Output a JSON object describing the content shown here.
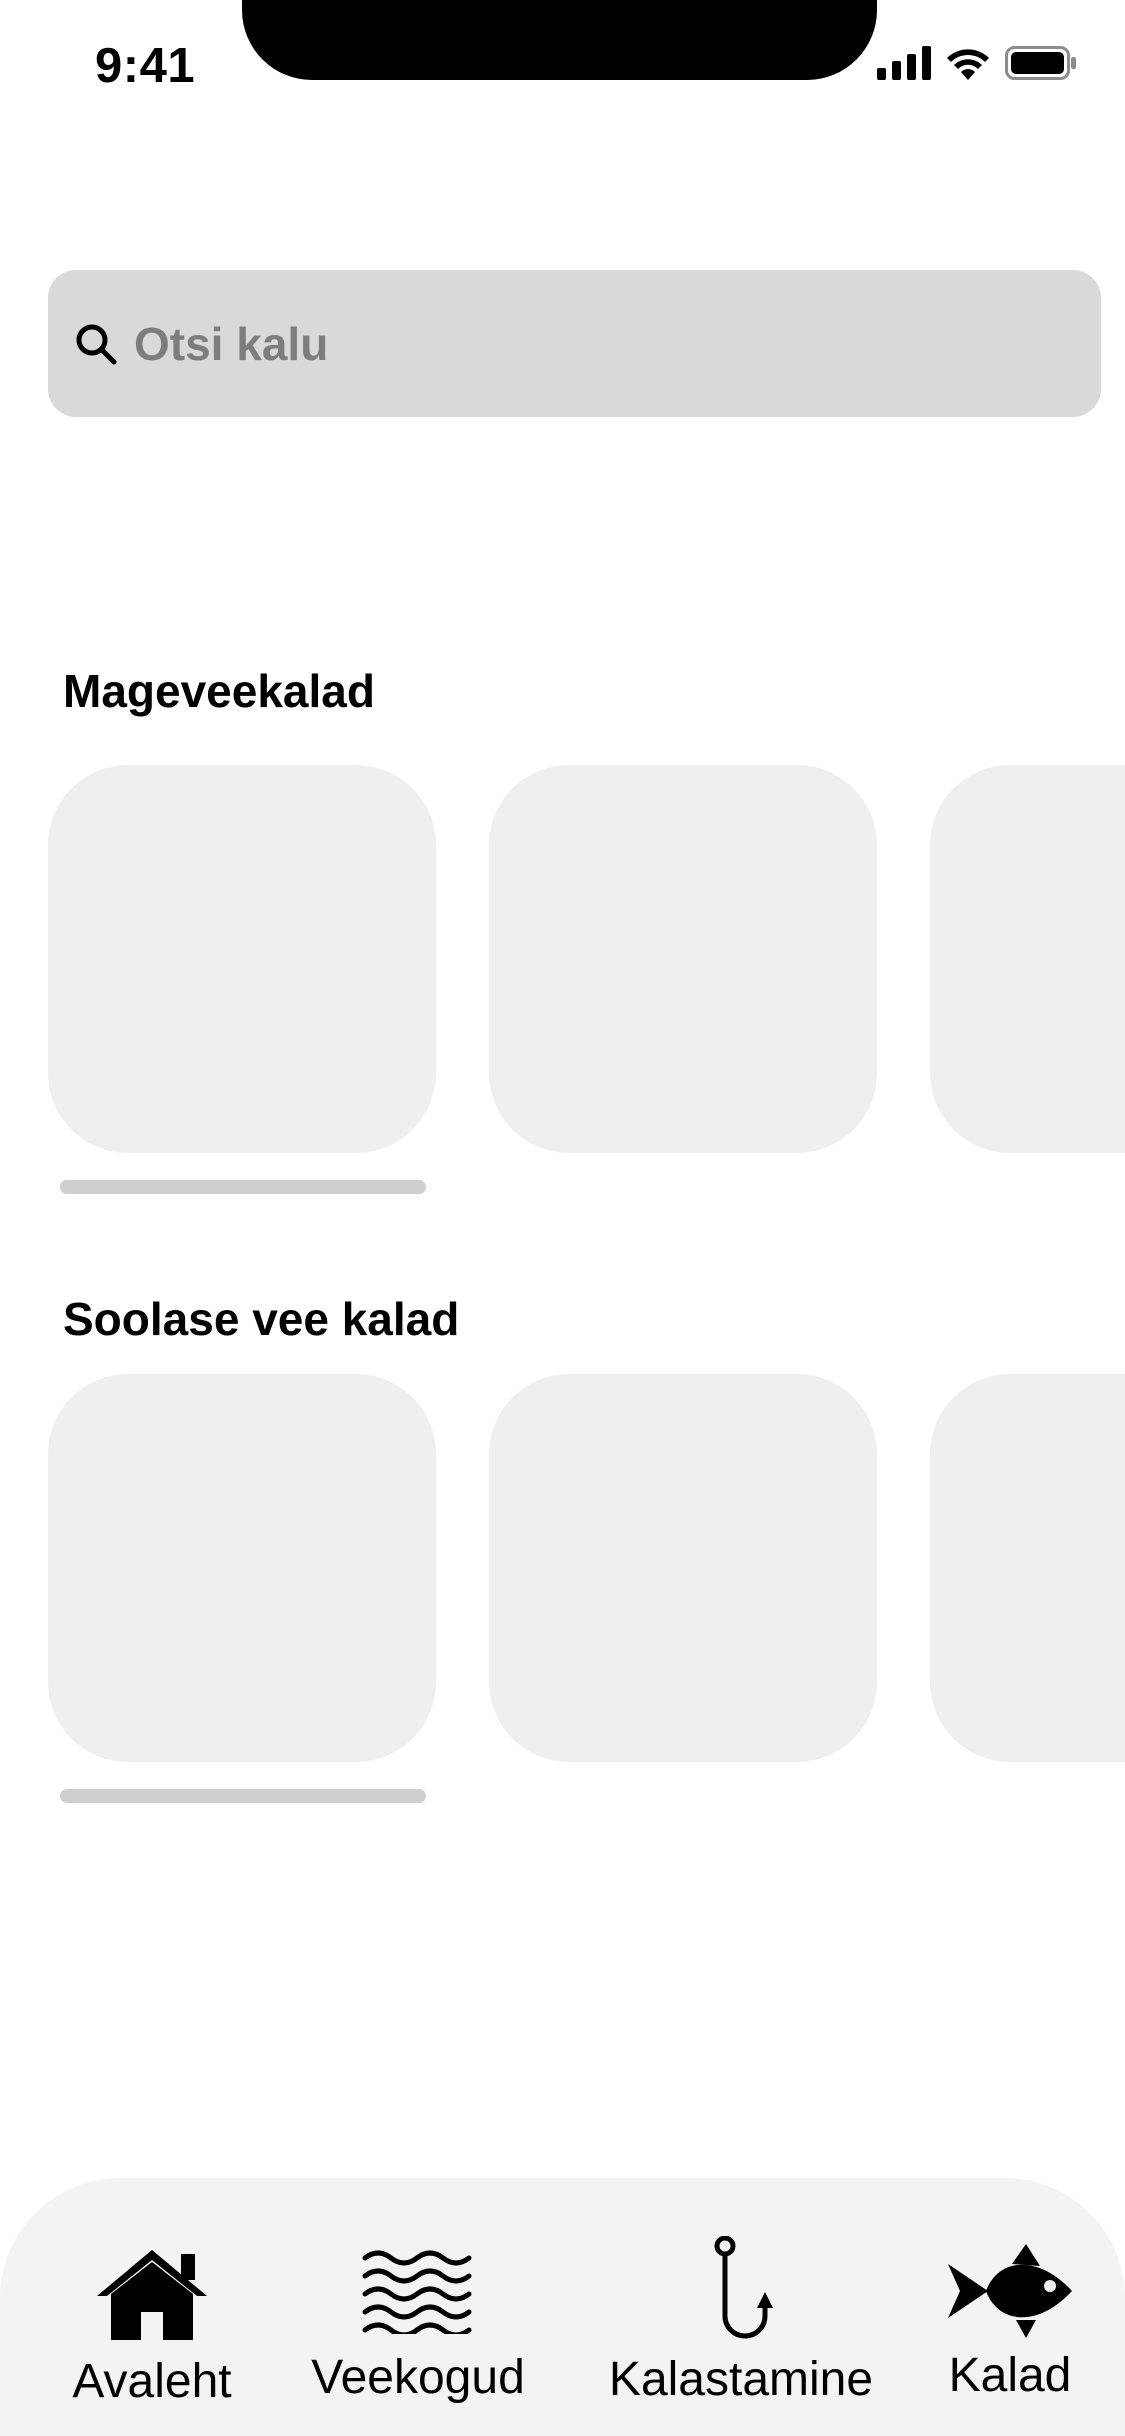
{
  "status_bar": {
    "time": "9:41"
  },
  "search": {
    "placeholder": "Otsi kalu",
    "icon": "search-icon"
  },
  "sections": [
    {
      "title": "Mageveekalad"
    },
    {
      "title": "Soolase vee kalad"
    }
  ],
  "tabbar": {
    "tabs": [
      {
        "label": "Avaleht",
        "icon": "home-icon"
      },
      {
        "label": "Veekogud",
        "icon": "waves-icon"
      },
      {
        "label": "Kalastamine",
        "icon": "fishing-hook-icon"
      },
      {
        "label": "Kalad",
        "icon": "fish-icon"
      }
    ]
  },
  "colors": {
    "search_bg": "#d9d9d9",
    "card_bg": "#efefef",
    "tabbar_bg": "#f3f3f3",
    "indicator": "#cfcfcf"
  }
}
